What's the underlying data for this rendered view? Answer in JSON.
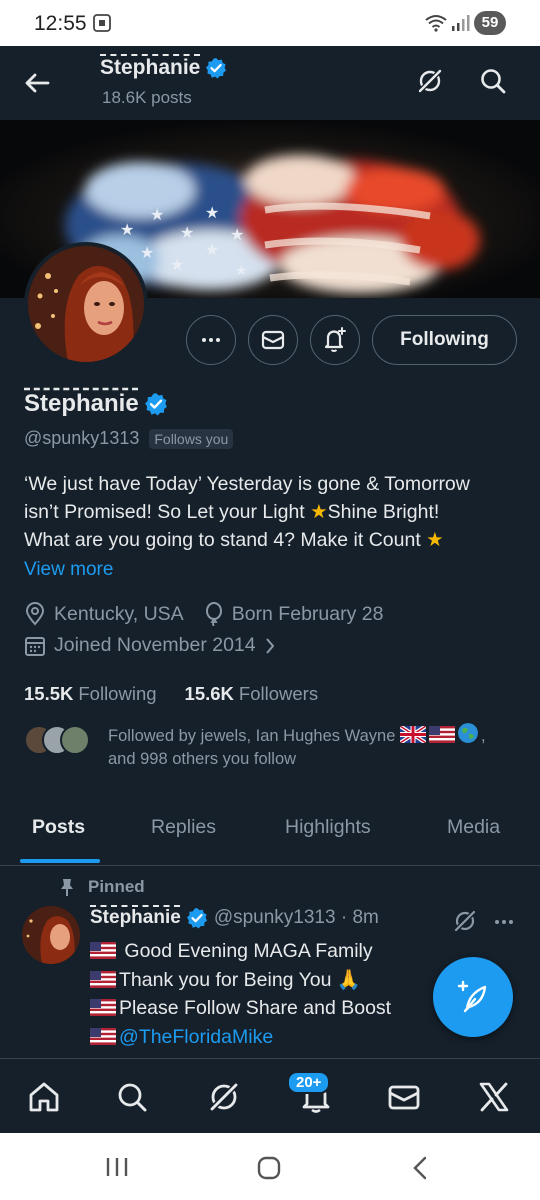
{
  "status_bar": {
    "time": "12:55",
    "battery": "59"
  },
  "header": {
    "name": "Stephanie",
    "posts_count": "18.6K posts",
    "icons": [
      "back-arrow-icon",
      "grok-icon",
      "search-icon"
    ]
  },
  "profile": {
    "name": "Stephanie",
    "handle": "@spunky1313",
    "follows_you": "Follows you",
    "action_buttons": [
      "more-icon",
      "message-icon",
      "notify-bell-icon"
    ],
    "following_button": "Following",
    "bio_lines": [
      "‘We just have Today’ Yesterday is gone & Tomorrow",
      "isn’t Promised! So  Let your Light",
      "Shine Bright!",
      "What  are you going to stand 4? Make it Count"
    ],
    "view_more": "View more",
    "location": "Kentucky, USA",
    "birthday": "Born February 28",
    "joined": "Joined November 2014",
    "following_count": "15.5K",
    "following_label": "Following",
    "followers_count": "15.6K",
    "followers_label": "Followers",
    "followed_by_line1": "Followed by jewels, Ian Hughes Wayne",
    "followed_by_line2": "and 998 others you follow"
  },
  "tabs": [
    {
      "label": "Posts",
      "active": true
    },
    {
      "label": "Replies",
      "active": false
    },
    {
      "label": "Highlights",
      "active": false
    },
    {
      "label": "Media",
      "active": false
    }
  ],
  "pinned_post": {
    "pinned_label": "Pinned",
    "author": "Stephanie",
    "handle_time": "@spunky1313 · 8m",
    "lines": [
      "Good Evening MAGA Family",
      "Thank you for Being You",
      "Please Follow Share and Boost",
      "@TheFloridaMike"
    ]
  },
  "bottom_nav": {
    "notification_badge": "20+",
    "icons": [
      "home-icon",
      "search-icon",
      "grok-icon",
      "notifications-icon",
      "messages-icon",
      "x-logo-icon"
    ]
  },
  "colors": {
    "background": "#15202b",
    "accent": "#1d9bf0",
    "text_primary": "#e7e9ea",
    "text_secondary": "#8b98a5",
    "border": "#38444d"
  }
}
